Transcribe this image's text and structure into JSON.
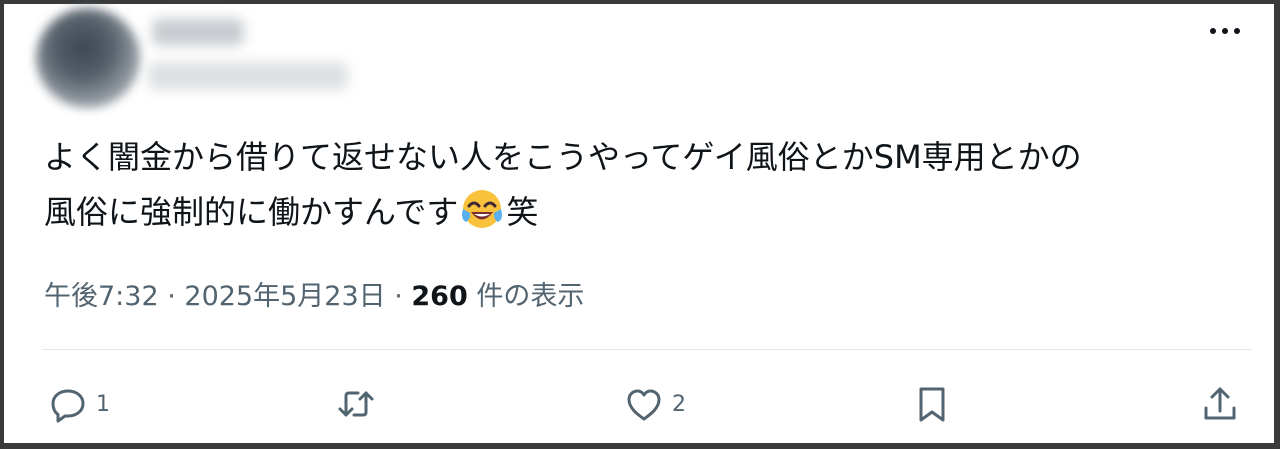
{
  "post": {
    "text_line1": "よく闇金から借りて返せない人をこうやってゲイ風俗とかSM専用とかの",
    "text_line2_before": "風俗に強制的に働かすんです",
    "emoji": "face-with-tears-of-joy",
    "text_line2_after": "笑"
  },
  "meta": {
    "time": "午後7:32",
    "sep1": " · ",
    "date": "2025年5月23日",
    "sep2": " · ",
    "view_count": "260",
    "view_label": " 件の表示"
  },
  "actions": {
    "reply_count": "1",
    "like_count": "2"
  },
  "colors": {
    "text": "#0f1419",
    "secondary": "#536471",
    "divider": "#e3e7ea"
  },
  "icons": [
    "more-icon",
    "reply-icon",
    "retweet-icon",
    "like-icon",
    "bookmark-icon",
    "share-icon"
  ]
}
